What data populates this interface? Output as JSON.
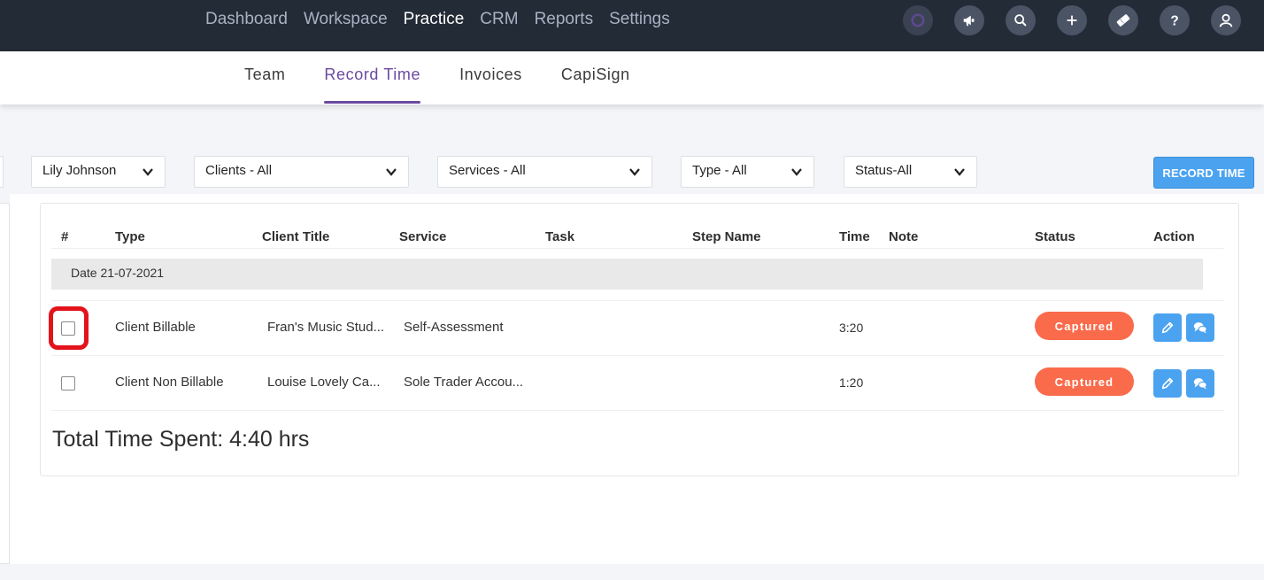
{
  "topnav": {
    "items": [
      "Dashboard",
      "Workspace",
      "Practice",
      "CRM",
      "Reports",
      "Settings"
    ],
    "active": "Practice",
    "icons": [
      "brand-logo-icon",
      "megaphone-icon",
      "search-icon",
      "plus-icon",
      "ticket-icon",
      "help-icon",
      "user-icon"
    ]
  },
  "subnav": {
    "items": [
      "Team",
      "Record Time",
      "Invoices",
      "CapiSign"
    ],
    "active": "Record Time"
  },
  "filters": {
    "user": "Lily Johnson",
    "clients": "Clients - All",
    "services": "Services - All",
    "type": "Type - All",
    "status": "Status-All"
  },
  "record_button": "RECORD TIME",
  "table": {
    "headers": {
      "num": "#",
      "type": "Type",
      "client_title": "Client Title",
      "service": "Service",
      "task": "Task",
      "step_name": "Step Name",
      "time": "Time",
      "note": "Note",
      "status": "Status",
      "action": "Action"
    },
    "date_group": "Date 21-07-2021",
    "rows": [
      {
        "type": "Client Billable",
        "client_title": "Fran's Music Stud...",
        "service": "Self-Assessment",
        "task": "",
        "step_name": "",
        "time": "3:20",
        "note": "",
        "status": "Captured"
      },
      {
        "type": "Client Non Billable",
        "client_title": "Louise Lovely Ca...",
        "service": "Sole Trader Accou...",
        "task": "",
        "step_name": "",
        "time": "1:20",
        "note": "",
        "status": "Captured"
      }
    ]
  },
  "total": "Total Time Spent: 4:40 hrs",
  "colors": {
    "topbar": "#232b37",
    "accent_purple": "#6b4aa0",
    "primary_blue": "#4ba3f0",
    "captured_badge": "#fa6b4b",
    "highlight_red": "#e3131b"
  }
}
